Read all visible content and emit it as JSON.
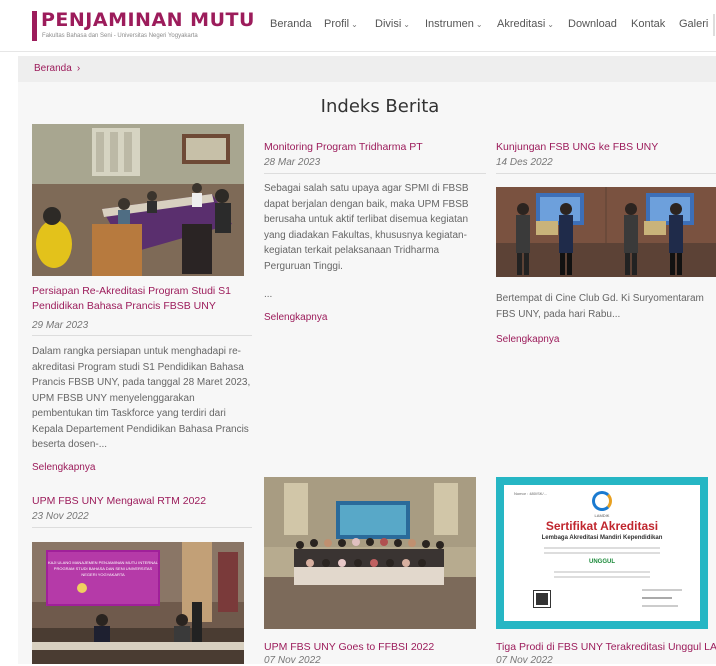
{
  "header": {
    "logo_title": "PENJAMINAN MUTU",
    "logo_subtitle": "Fakultas Bahasa dan Seni - Universitas Negeri Yogyakarta",
    "nav": [
      {
        "label": "Beranda"
      },
      {
        "label": "Profil",
        "dropdown": true
      },
      {
        "label": "Divisi",
        "dropdown": true
      },
      {
        "label": "Instrumen",
        "dropdown": true
      },
      {
        "label": "Akreditasi",
        "dropdown": true
      },
      {
        "label": "Download"
      },
      {
        "label": "Kontak"
      },
      {
        "label": "Galeri"
      }
    ]
  },
  "breadcrumb": {
    "home": "Beranda",
    "separator": "›"
  },
  "page_title": "Indeks Berita",
  "read_more": "Selengkapnya",
  "posts": [
    {
      "title_lines": [
        "Persiapan Re-Akreditasi Program Studi S1",
        "Pendidikan Bahasa Prancis FBSB UNY"
      ],
      "date": "29 Mar 2023",
      "excerpt_lines": [
        "Dalam rangka persiapan untuk menghadapi re-",
        "akreditasi Program studi S1 Pendidikan Bahasa",
        "Prancis FBSB UNY, pada tanggal 28 Maret 2023,",
        "UPM FBSB UNY menyelenggarakan",
        "pembentukan tim Taskforce yang terdiri dari",
        "Kepala Departement Pendidikan Bahasa Prancis",
        "beserta dosen-..."
      ]
    },
    {
      "title_lines": [
        "Monitoring Program Tridharma PT"
      ],
      "date": "28 Mar 2023",
      "excerpt_lines": [
        "Sebagai salah satu upaya agar SPMI di FBSB",
        "dapat berjalan dengan baik, maka UPM FBSB",
        "berusaha untuk aktif terlibat disemua kegiatan",
        "yang diadakan Fakultas, khususnya kegiatan-",
        "kegiatan terkait pelaksanaan Tridharma",
        "Perguruan Tinggi."
      ],
      "ellipsis": "..."
    },
    {
      "title_lines": [
        "Kunjungan FSB UNG ke FBS UNY"
      ],
      "date": "14 Des 2022",
      "excerpt_lines": [
        "Bertempat di Cine Club Gd. Ki Suryomentaram",
        "FBS UNY, pada hari Rabu..."
      ]
    },
    {
      "title_lines": [
        "UPM FBS UNY Mengawal RTM 2022"
      ],
      "date": "23 Nov 2022"
    },
    {
      "title_lines": [
        "UPM FBS UNY Goes to FFBSI 2022"
      ],
      "date": "07 Nov 2022"
    },
    {
      "title_lines": [
        "Tiga Prodi di FBS UNY Terakreditasi Unggul LAMDIK"
      ],
      "date": "07 Nov 2022"
    }
  ],
  "certificate": {
    "heading": "Sertifikat Akreditasi",
    "subheading": "Lembaga Akreditasi Mandiri Kependidikan",
    "grade": "UNGGUL",
    "org": "LAMDIK",
    "ref": "Nomor : 480/SK/..."
  },
  "rtm_banner": {
    "line1": "KAJI ULANG MANAJEMEN PENJAMINAN MUTU INTERNAL",
    "line2": "PROGRAM STUDI BAHASA DAN SENI UNIVERSITAS",
    "line3": "NEGERI YOGYAKARTA"
  },
  "colors": {
    "accent": "#9c1c5b",
    "text": "#666666",
    "background": "#f7f7f7"
  }
}
